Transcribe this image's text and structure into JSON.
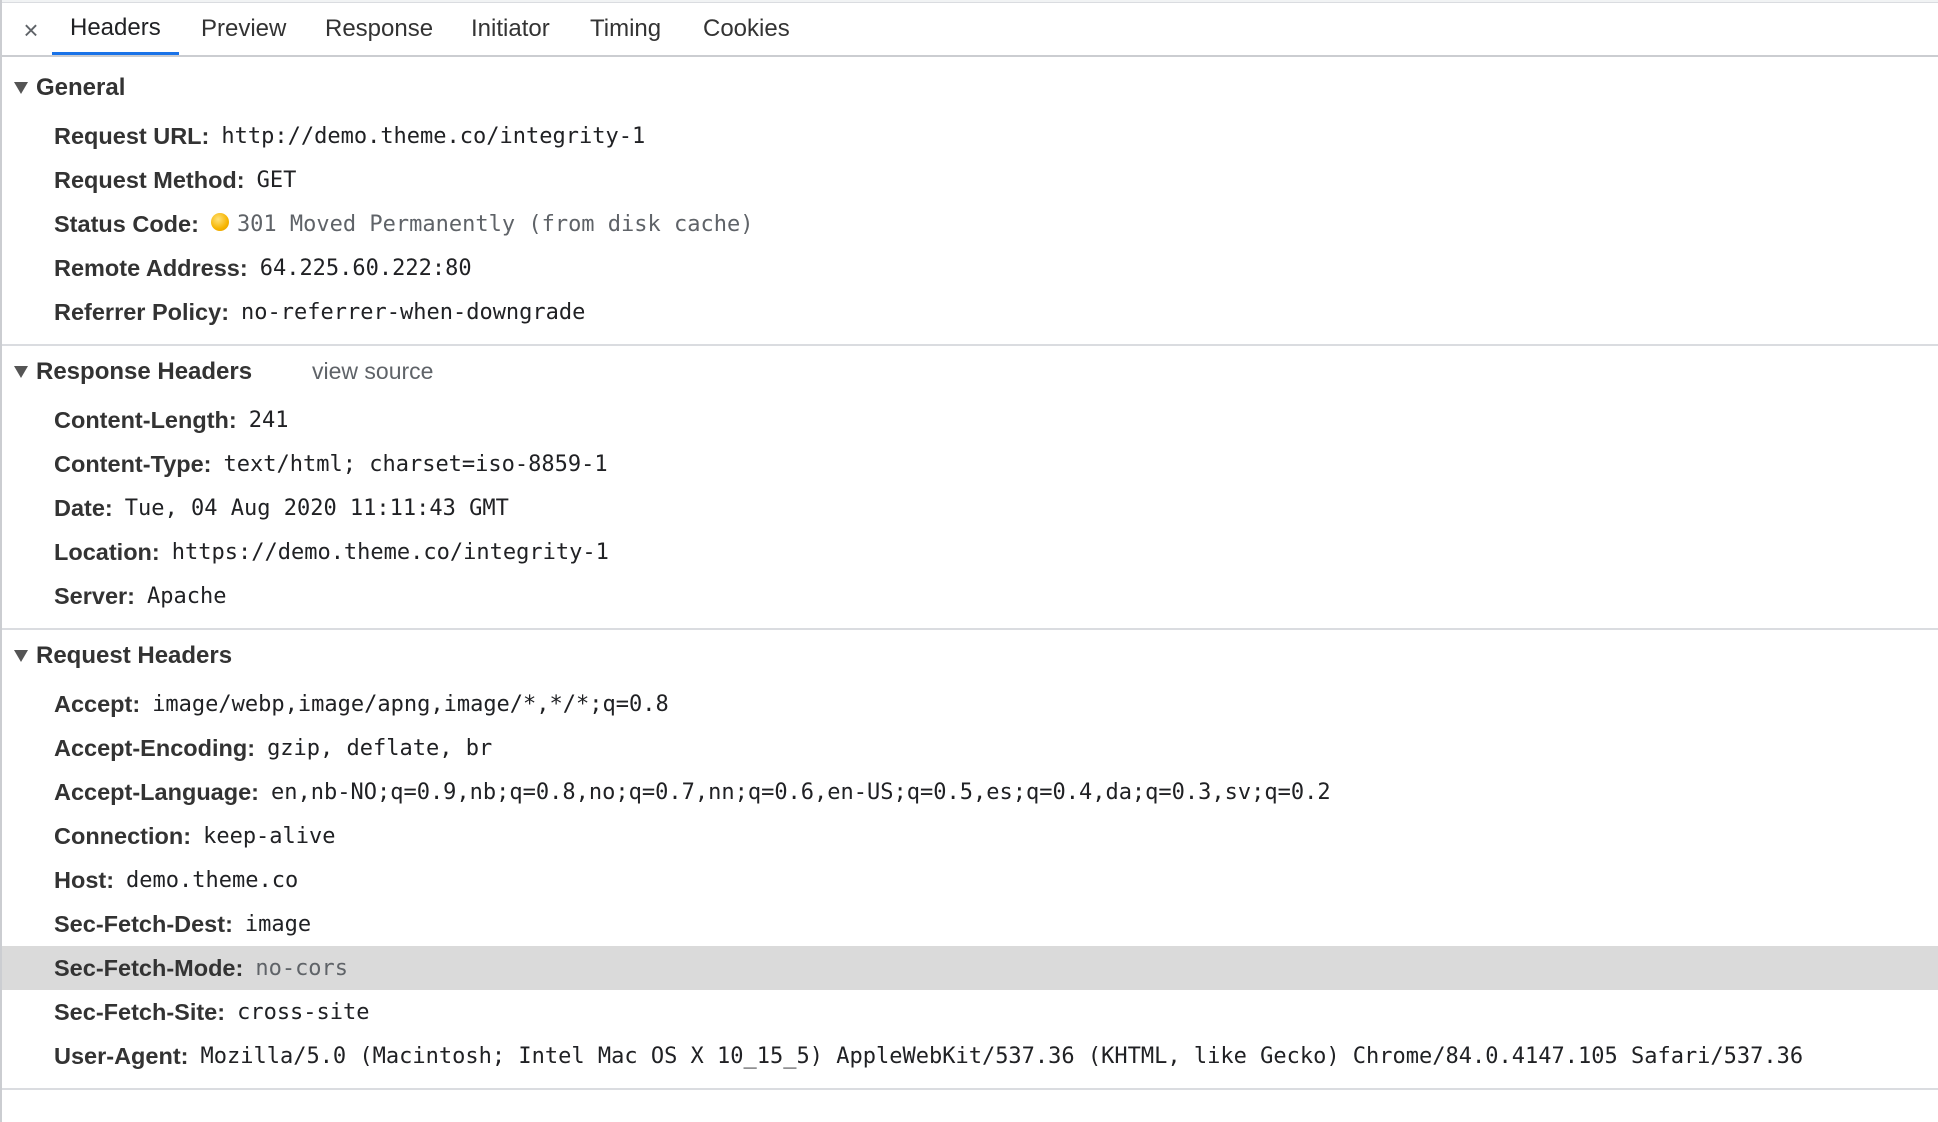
{
  "tabs": {
    "close": "×",
    "items": [
      "Headers",
      "Preview",
      "Response",
      "Initiator",
      "Timing",
      "Cookies"
    ],
    "active": "Headers",
    "accent_color": "#1a73e8"
  },
  "general": {
    "title": "General",
    "rows": [
      {
        "key": "Request URL:",
        "value": "http://demo.theme.co/integrity-1"
      },
      {
        "key": "Request Method:",
        "value": "GET"
      },
      {
        "key": "Status Code:",
        "value": "301 Moved Permanently (from disk cache)",
        "status_color": "#f6b400"
      },
      {
        "key": "Remote Address:",
        "value": "64.225.60.222:80"
      },
      {
        "key": "Referrer Policy:",
        "value": "no-referrer-when-downgrade"
      }
    ]
  },
  "response_headers": {
    "title": "Response Headers",
    "view_source": "view source",
    "rows": [
      {
        "key": "Content-Length:",
        "value": "241"
      },
      {
        "key": "Content-Type:",
        "value": "text/html; charset=iso-8859-1"
      },
      {
        "key": "Date:",
        "value": "Tue, 04 Aug 2020 11:11:43 GMT"
      },
      {
        "key": "Location:",
        "value": "https://demo.theme.co/integrity-1"
      },
      {
        "key": "Server:",
        "value": "Apache"
      }
    ]
  },
  "request_headers": {
    "title": "Request Headers",
    "rows": [
      {
        "key": "Accept:",
        "value": "image/webp,image/apng,image/*,*/*;q=0.8"
      },
      {
        "key": "Accept-Encoding:",
        "value": "gzip, deflate, br"
      },
      {
        "key": "Accept-Language:",
        "value": "en,nb-NO;q=0.9,nb;q=0.8,no;q=0.7,nn;q=0.6,en-US;q=0.5,es;q=0.4,da;q=0.3,sv;q=0.2"
      },
      {
        "key": "Connection:",
        "value": "keep-alive"
      },
      {
        "key": "Host:",
        "value": "demo.theme.co"
      },
      {
        "key": "Sec-Fetch-Dest:",
        "value": "image"
      },
      {
        "key": "Sec-Fetch-Mode:",
        "value": "no-cors"
      },
      {
        "key": "Sec-Fetch-Site:",
        "value": "cross-site"
      },
      {
        "key": "User-Agent:",
        "value": "Mozilla/5.0 (Macintosh; Intel Mac OS X 10_15_5) AppleWebKit/537.36 (KHTML, like Gecko) Chrome/84.0.4147.105 Safari/537.36"
      }
    ]
  }
}
